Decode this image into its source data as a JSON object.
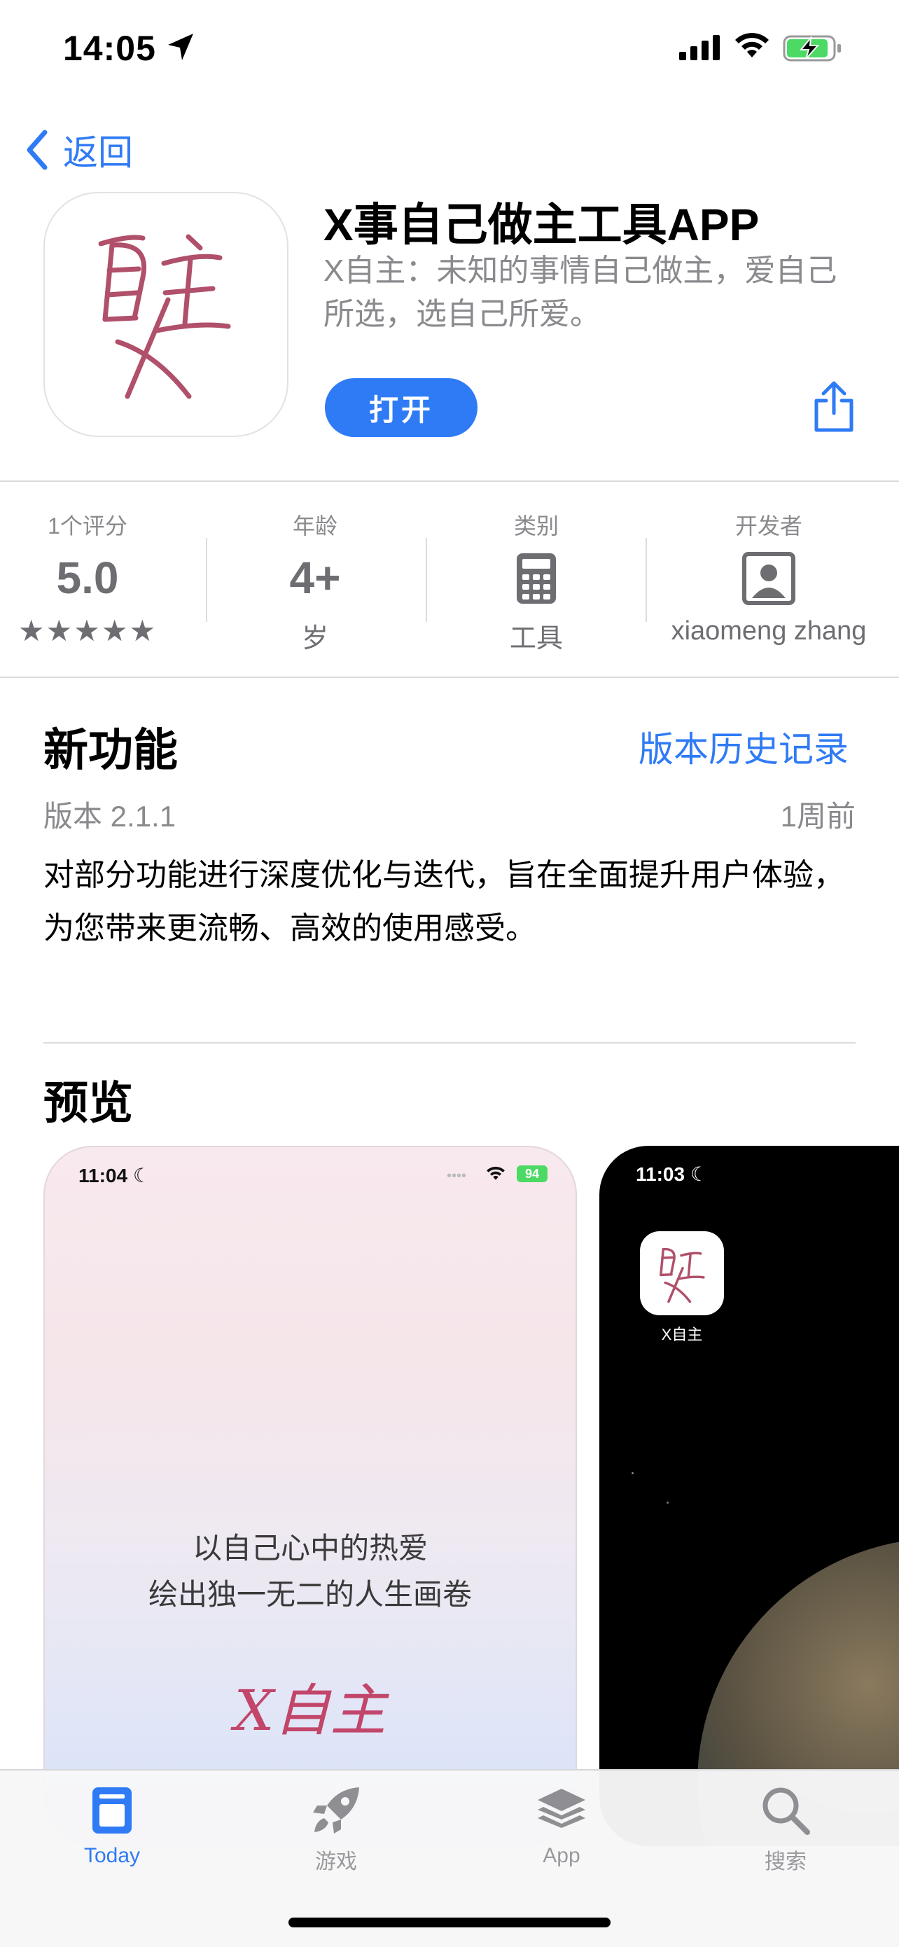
{
  "status_bar": {
    "time": "14:05"
  },
  "nav": {
    "back_label": "返回"
  },
  "app": {
    "title": "X事自己做主工具APP",
    "subtitle": "X自主：未知的事情自己做主，爱自己所选，选自己所爱。",
    "open_label": "打开"
  },
  "stats": [
    {
      "label": "1个评分",
      "value": "5.0",
      "sub": "★★★★★"
    },
    {
      "label": "年龄",
      "value": "4+",
      "sub": "岁"
    },
    {
      "label": "类别",
      "value": "",
      "sub": "工具"
    },
    {
      "label": "开发者",
      "value": "",
      "sub": "xiaomeng zhang"
    }
  ],
  "rating": {
    "stars": 5
  },
  "whats_new": {
    "heading": "新功能",
    "history_link": "版本历史记录",
    "version": "版本 2.1.1",
    "time_ago": "1周前",
    "notes": "对部分功能进行深度优化与迭代，旨在全面提升用户体验，为您带来更流畅、高效的使用感受。"
  },
  "preview": {
    "heading": "预览",
    "shot1": {
      "time": "11:04",
      "battery": "94",
      "tagline_line1": "以自己心中的热爱",
      "tagline_line2": "绘出独一无二的人生画卷",
      "signature": "X自主"
    },
    "shot2": {
      "time": "11:03",
      "app_label": "X自主"
    }
  },
  "tabbar": {
    "items": [
      {
        "label": "Today",
        "icon": "today-icon",
        "active": true
      },
      {
        "label": "游戏",
        "icon": "rocket-icon",
        "active": false
      },
      {
        "label": "App",
        "icon": "app-stack-icon",
        "active": false
      },
      {
        "label": "搜索",
        "icon": "search-icon",
        "active": false
      }
    ]
  },
  "colors": {
    "accent": "#2f7bf5",
    "battery_green": "#4cd964",
    "icon_ink": "#b0506a"
  }
}
